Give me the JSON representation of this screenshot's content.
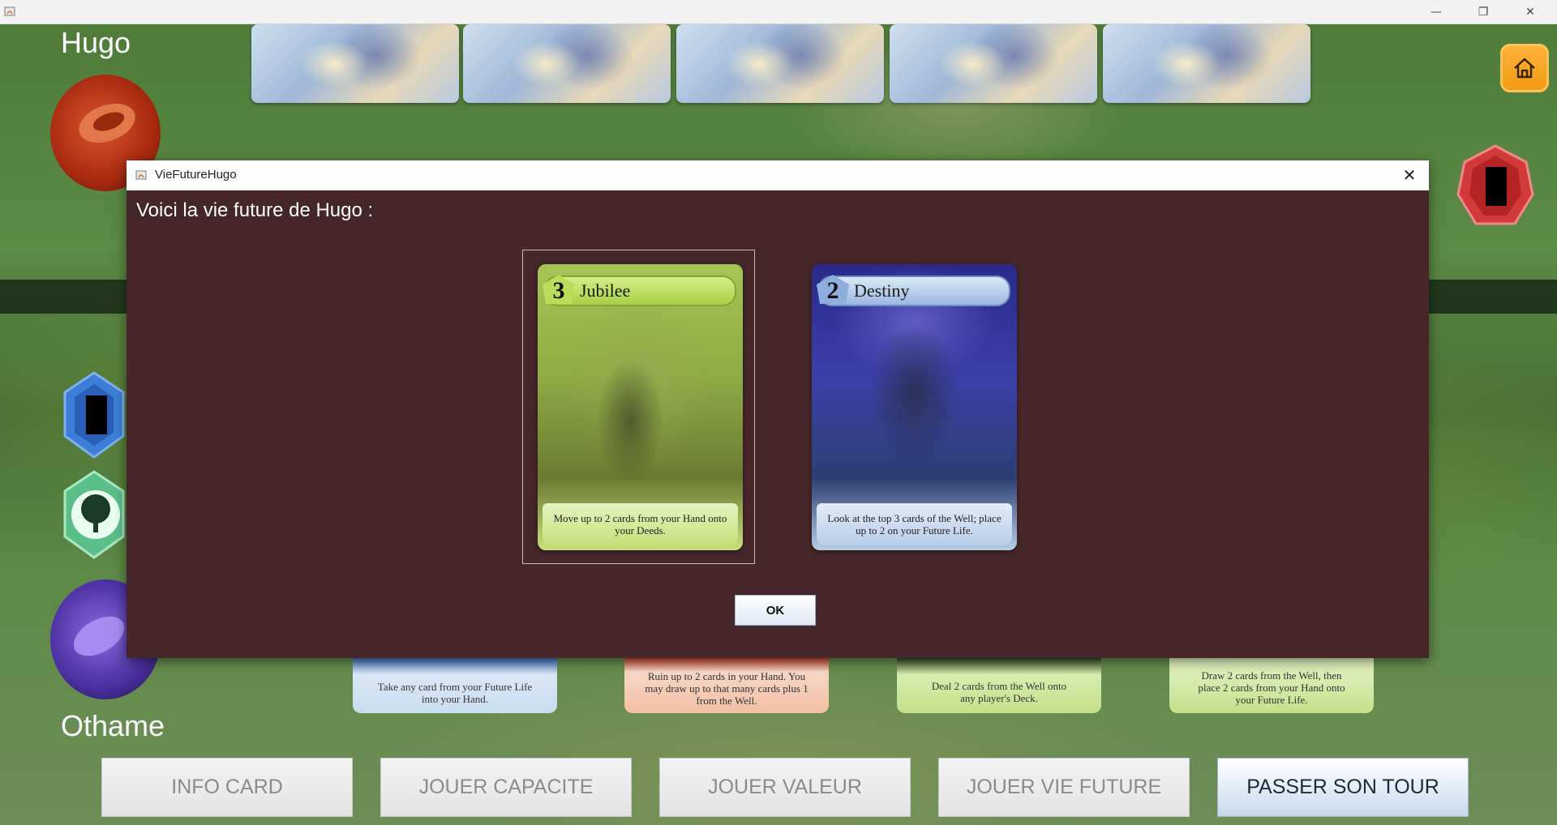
{
  "window": {
    "minimize_icon": "minimize-icon",
    "maximize_icon": "restore-icon",
    "close_icon": "close-icon"
  },
  "players": {
    "top_name": "Hugo",
    "bottom_name": "Othame"
  },
  "deck_cards_top_count_label": "",
  "bottom_cards": [
    {
      "text": "Take any card from your Future Life into your Hand.",
      "color": "#6f9fd8"
    },
    {
      "text": "Ruin up to 2 cards in your Hand. You may draw up to that many cards plus 1 from the Well.",
      "color": "#e58a5a"
    },
    {
      "text": "Deal 2 cards from the Well onto any player's Deck.",
      "color": "#9cc45a"
    },
    {
      "text": "Draw 2 cards from the Well, then place 2 cards from your Hand onto your Future Life.",
      "color": "#a9cf6a"
    }
  ],
  "action_buttons": {
    "info_card": "INFO CARD",
    "jouer_capacite": "JOUER CAPACITE",
    "jouer_valeur": "JOUER VALEUR",
    "jouer_vie_future": "JOUER VIE FUTURE",
    "passer_son_tour": "PASSER SON TOUR"
  },
  "dialog": {
    "title": "VieFutureHugo",
    "message": "Voici la vie future de Hugo :",
    "ok_label": "OK",
    "cards": [
      {
        "value": "3",
        "name": "Jubilee",
        "text": "Move up to 2 cards from your Hand onto your Deeds.",
        "selected": true
      },
      {
        "value": "2",
        "name": "Destiny",
        "text": "Look at the top 3 cards of the Well; place up to 2 on your Future Life.",
        "selected": false
      }
    ]
  }
}
